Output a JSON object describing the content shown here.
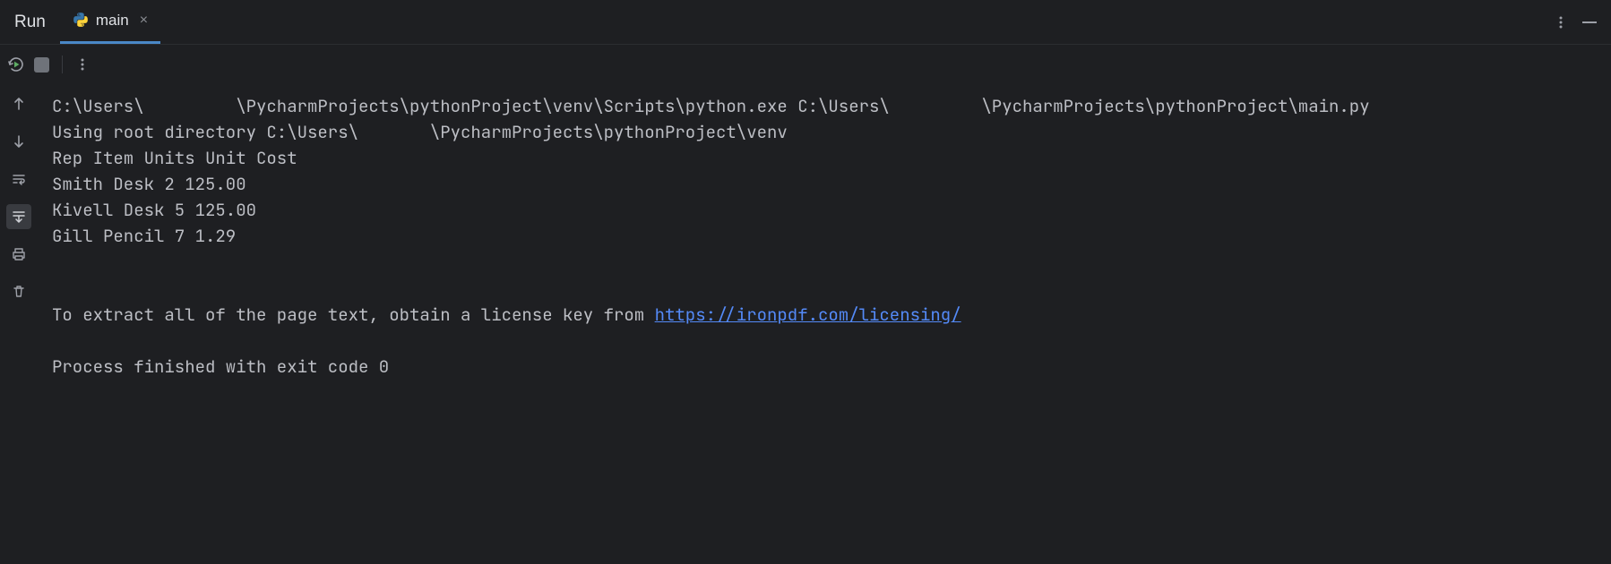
{
  "header": {
    "run_label": "Run",
    "tab_name": "main"
  },
  "console": {
    "line1": "C:\\Users\\         \\PycharmProjects\\pythonProject\\venv\\Scripts\\python.exe C:\\Users\\         \\PycharmProjects\\pythonProject\\main.py ",
    "line2": "Using root directory C:\\Users\\       \\PycharmProjects\\pythonProject\\venv",
    "line3": "Rep Item Units Unit Cost",
    "line4": "Smith Desk 2 125.00",
    "line5": "Kivell Desk 5 125.00",
    "line6": "Gill Pencil 7 1.29",
    "blank1": "",
    "blank2": "",
    "license_prefix": "To extract all of the page text, obtain a license key from ",
    "license_link": "https://ironpdf.com/licensing/",
    "blank3": "",
    "exit_line": "Process finished with exit code 0"
  }
}
